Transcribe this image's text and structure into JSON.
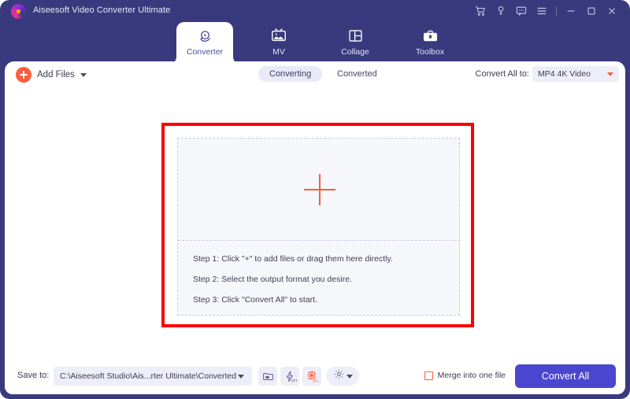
{
  "window": {
    "title": "Aiseesoft Video Converter Ultimate",
    "logo_icon": "aiseesoft-logo-icon",
    "controls": [
      {
        "name": "cart-icon",
        "label": "Cart"
      },
      {
        "name": "key-icon",
        "label": "Register"
      },
      {
        "name": "comment-icon",
        "label": "Feedback"
      },
      {
        "name": "menu-icon",
        "label": "Menu"
      },
      {
        "name": "minimize-icon",
        "label": "Minimize"
      },
      {
        "name": "maximize-icon",
        "label": "Maximize"
      },
      {
        "name": "close-icon",
        "label": "Close"
      }
    ]
  },
  "tabs": [
    {
      "label": "Converter",
      "icon": "converter-icon",
      "active": true
    },
    {
      "label": "MV",
      "icon": "mv-icon",
      "active": false
    },
    {
      "label": "Collage",
      "icon": "collage-icon",
      "active": false
    },
    {
      "label": "Toolbox",
      "icon": "toolbox-icon",
      "active": false
    }
  ],
  "toolbar": {
    "add_files_label": "Add Files",
    "add_files_icon": "plus-circle-icon",
    "add_files_caret": "chevron-down-icon",
    "segments": [
      {
        "label": "Converting",
        "active": true
      },
      {
        "label": "Converted",
        "active": false
      }
    ],
    "convert_all_to_label": "Convert All to:",
    "format_value": "MP4 4K Video",
    "format_caret_icon": "caret-down-icon"
  },
  "dropzone": {
    "plus_icon": "plus-icon",
    "steps": [
      "Step 1: Click \"+\" to add files or drag them here directly.",
      "Step 2: Select the output format you desire.",
      "Step 3: Click \"Convert All\" to start."
    ],
    "highlight_color": "#FF0000"
  },
  "bottom": {
    "save_to_label": "Save to:",
    "save_path": "C:\\Aiseesoft Studio\\Ais...rter Ultimate\\Converted",
    "save_caret_icon": "chevron-down-icon",
    "buttons": [
      {
        "name": "open-folder-icon",
        "label": "Open Folder"
      },
      {
        "name": "high-speed-icon",
        "label": "OFF"
      },
      {
        "name": "gpu-acceleration-icon",
        "label": "ON"
      },
      {
        "name": "settings-gear-icon",
        "label": "Preferences"
      }
    ],
    "speed_state": "OFF",
    "gpu_state": "ON",
    "merge_label": "Merge into one file",
    "merge_checked": false,
    "convert_all_label": "Convert All"
  },
  "colors": {
    "frame": "#393A7E",
    "accent_orange": "#FB5E3D",
    "accent_purple": "#4B46CF",
    "panel": "#FFFFFF",
    "dropzone_bg": "#F5F7FB",
    "segment_active": "#E9EAF8"
  }
}
